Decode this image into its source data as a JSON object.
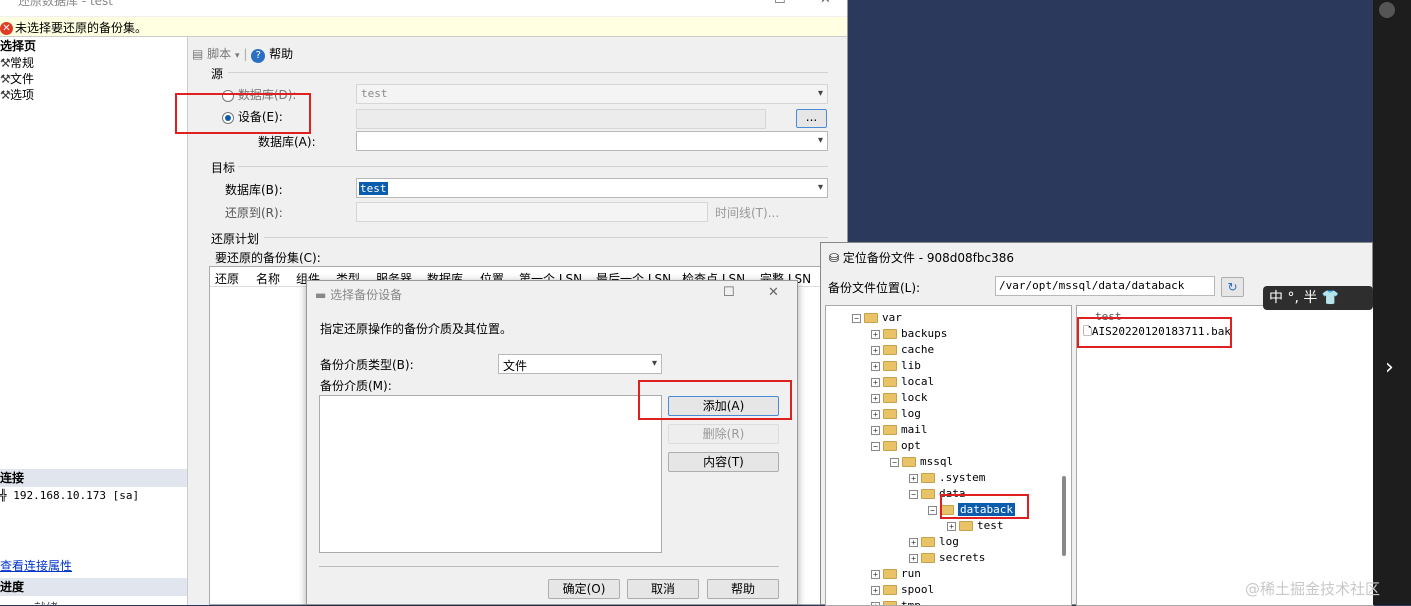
{
  "main_window": {
    "title": "还原数据库 - test",
    "warning": "未选择要还原的备份集。",
    "left": {
      "select_page": "选择页",
      "pages": [
        "常规",
        "文件",
        "选项"
      ],
      "connection_header": "连接",
      "server": "192.168.10.173 [sa]",
      "view_conn_link": "查看连接属性",
      "progress_header": "进度",
      "progress_status": "就绪"
    },
    "toolbar": {
      "script": "脚本",
      "help": "帮助"
    },
    "source": {
      "header": "源",
      "database_radio": "数据库(D):",
      "database_value": "test",
      "device_radio": "设备(E):",
      "browse_button": "...",
      "db_label": "数据库(A):"
    },
    "target": {
      "header": "目标",
      "db_label": "数据库(B):",
      "db_value": "test",
      "restore_to_label": "还原到(R):",
      "timeline_button": "时间线(T)..."
    },
    "plan": {
      "header": "还原计划",
      "backup_sets_label": "要还原的备份集(C):",
      "columns": [
        "还原",
        "名称",
        "组件",
        "类型",
        "服务器",
        "数据库",
        "位置",
        "第一个 LSN",
        "最后一个 LSN",
        "检查点 LSN",
        "完整 LSN"
      ]
    }
  },
  "select_device_dialog": {
    "title": "选择备份设备",
    "instruction": "指定还原操作的备份介质及其位置。",
    "media_type_label": "备份介质类型(B):",
    "media_type_value": "文件",
    "media_label": "备份介质(M):",
    "add_button": "添加(A)",
    "remove_button": "删除(R)",
    "contents_button": "内容(T)",
    "ok_button": "确定(O)",
    "cancel_button": "取消",
    "help_button": "帮助"
  },
  "locate_dialog": {
    "title": "定位备份文件 - 908d08fbc386",
    "location_label": "备份文件位置(L):",
    "location_value": "/var/opt/mssql/data/databack",
    "tree": [
      "var",
      "backups",
      "cache",
      "lib",
      "local",
      "lock",
      "log",
      "mail",
      "opt",
      "mssql",
      ".system",
      "data",
      "databack",
      "test",
      "log",
      "secrets",
      "run",
      "spool",
      "tmp"
    ],
    "files": [
      "test",
      "AIS20220120183711.bak"
    ]
  },
  "ime": {
    "text": "中 °, 半"
  },
  "watermark": "@稀土掘金技术社区",
  "colors": {
    "highlight": "#0b5cad",
    "red_annotation": "#e0201f",
    "dark_bg": "#2b3a5c"
  },
  "icons": [
    "warning-icon",
    "wrench-icon",
    "help-icon",
    "script-icon",
    "folder-icon",
    "refresh-icon",
    "database-icon",
    "next-arrow-icon"
  ]
}
